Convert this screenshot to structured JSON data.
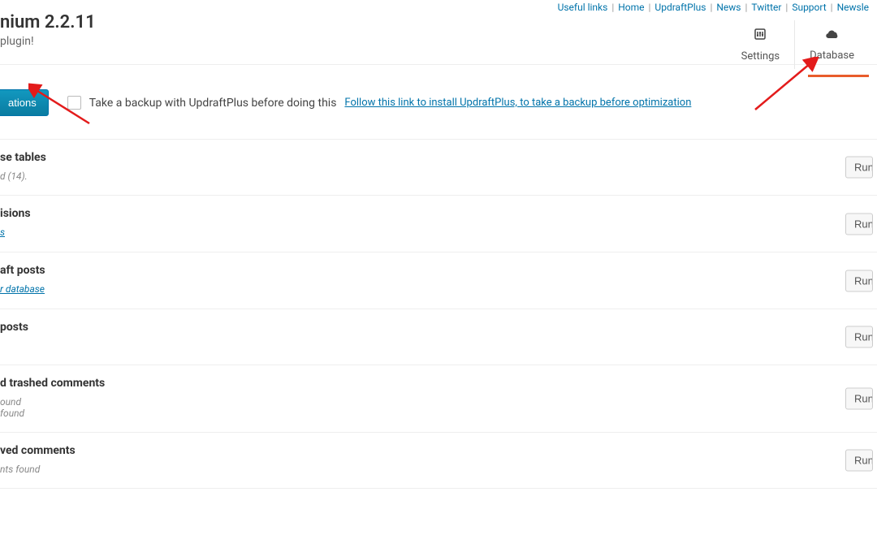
{
  "top_nav": {
    "useful_links": "Useful links",
    "home": "Home",
    "updraftplus": "UpdraftPlus",
    "news": "News",
    "twitter": "Twitter",
    "support": "Support",
    "newsletter": "Newsle"
  },
  "header": {
    "title": "nium 2.2.11",
    "subtitle": "plugin!"
  },
  "tabs": {
    "settings": "Settings",
    "database": "Database"
  },
  "action_bar": {
    "run_all": "ations",
    "backup_label": "Take a backup with UpdraftPlus before doing this",
    "install_link": "Follow this link to install UpdraftPlus, to take a backup before optimization"
  },
  "sections": {
    "tables": {
      "title": "se tables",
      "desc": "d (14)."
    },
    "revisions": {
      "title": "isions",
      "desc_link": "s"
    },
    "drafts": {
      "title": "aft posts",
      "desc_link": "r database"
    },
    "trashed_posts": {
      "title": "posts"
    },
    "comments": {
      "title": "d trashed comments",
      "desc1": "ound",
      "desc2": "found"
    },
    "unapproved": {
      "title": "ved comments",
      "desc": "nts found"
    }
  },
  "run_button": "Run"
}
